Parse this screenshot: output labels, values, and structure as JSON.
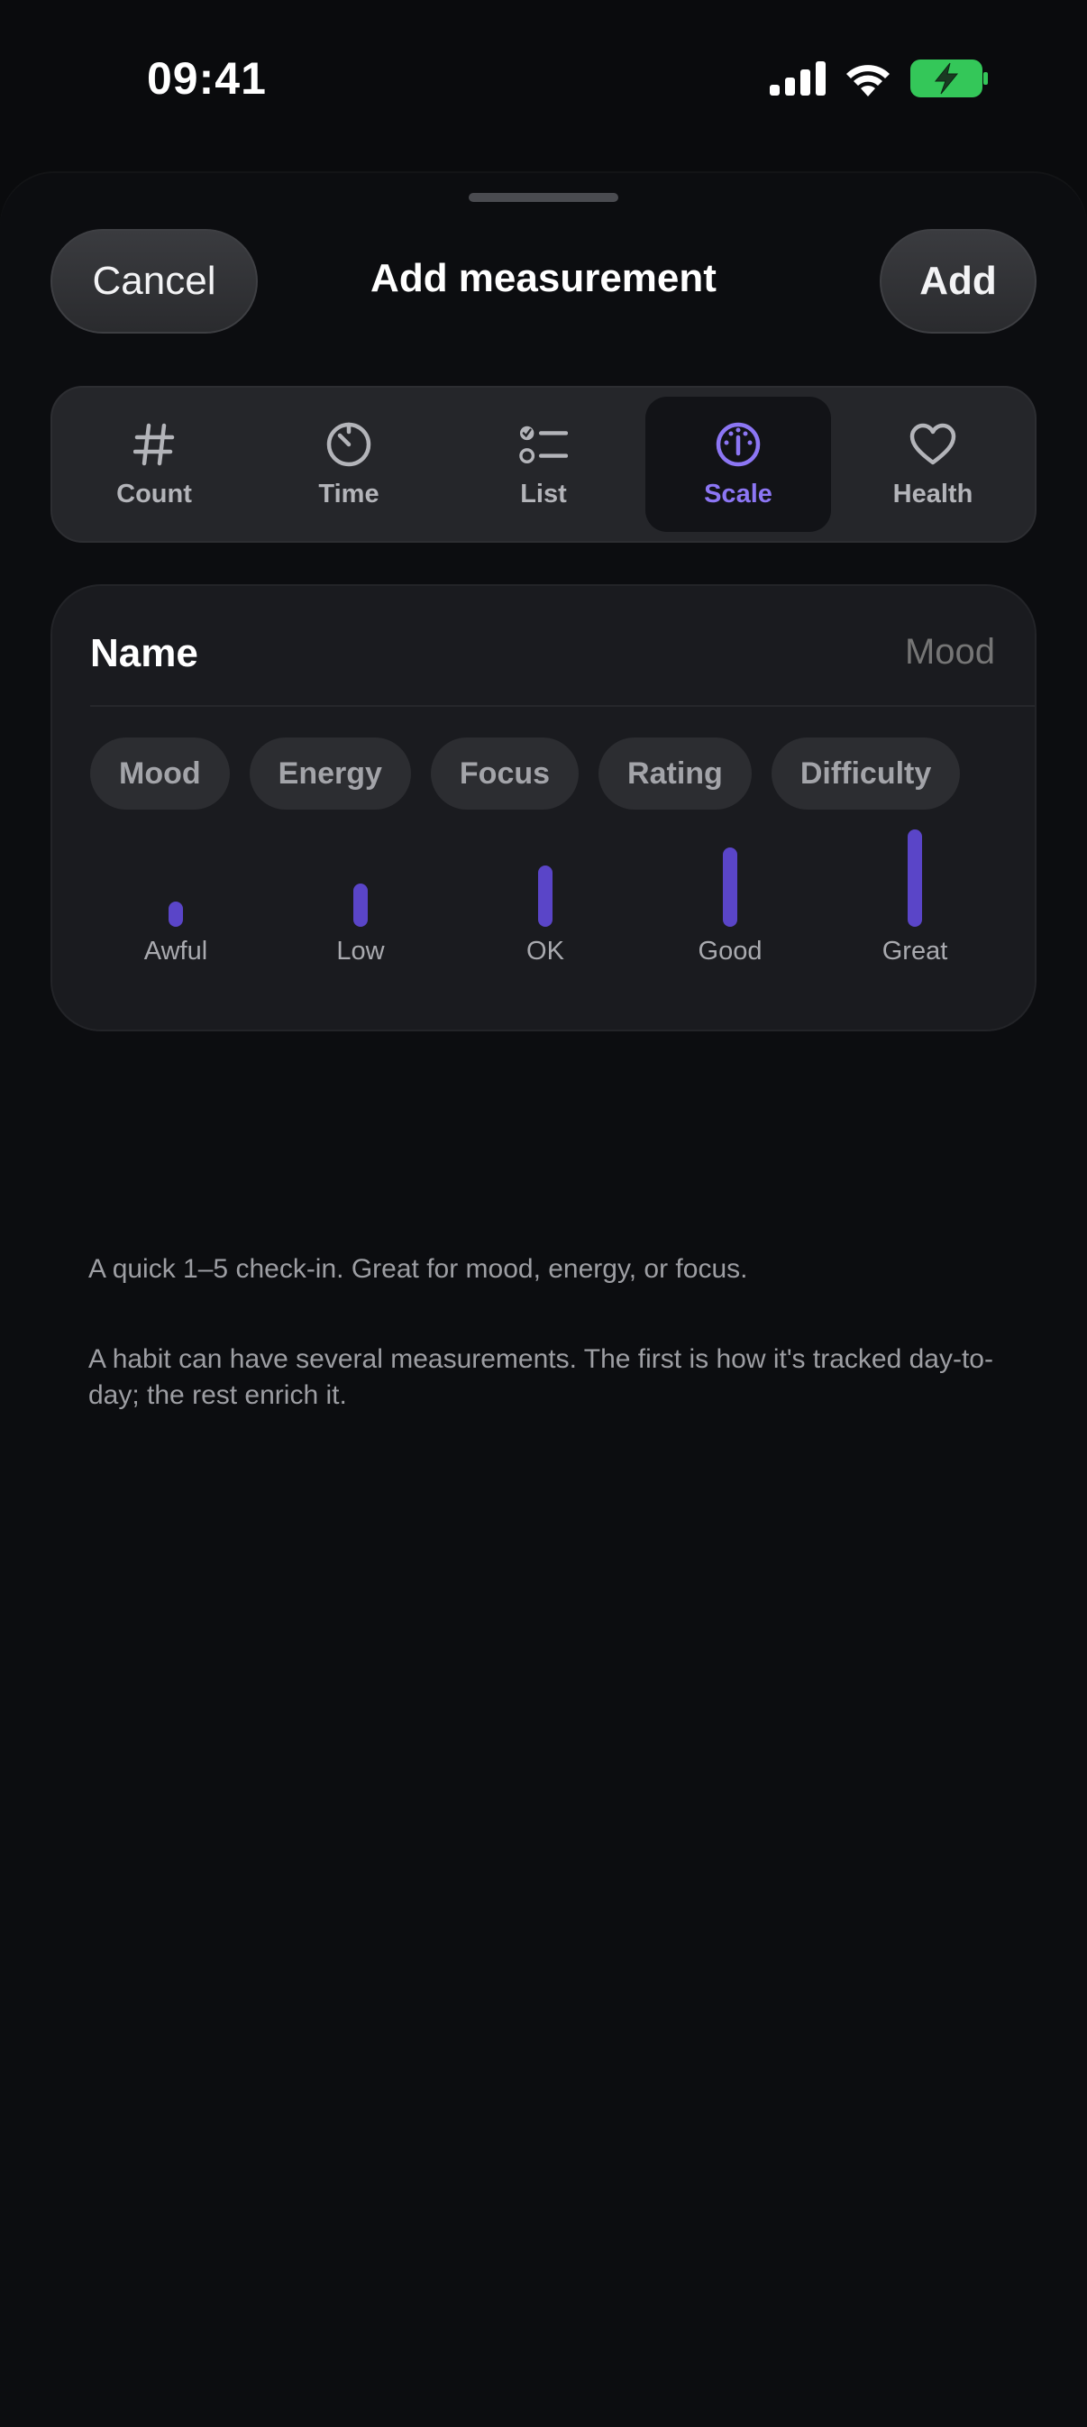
{
  "status_bar": {
    "time": "09:41",
    "icons": [
      "cellular-signal-icon",
      "wifi-icon",
      "battery-charging-icon"
    ],
    "battery_color": "#34c759"
  },
  "header": {
    "cancel_label": "Cancel",
    "title": "Add measurement",
    "add_label": "Add"
  },
  "types": {
    "selected": "Scale",
    "accent_color": "#8c76f4",
    "items": [
      {
        "label": "Count",
        "icon": "hash-icon"
      },
      {
        "label": "Time",
        "icon": "timer-icon"
      },
      {
        "label": "List",
        "icon": "checklist-icon"
      },
      {
        "label": "Scale",
        "icon": "gauge-icon"
      },
      {
        "label": "Health",
        "icon": "heart-icon"
      }
    ]
  },
  "form": {
    "name_label": "Name",
    "name_placeholder": "Mood",
    "name_value": "",
    "suggestions": [
      "Mood",
      "Energy",
      "Focus",
      "Rating",
      "Difficulty"
    ],
    "scale": {
      "levels": [
        {
          "label": "Awful",
          "value": 1
        },
        {
          "label": "Low",
          "value": 2
        },
        {
          "label": "OK",
          "value": 3
        },
        {
          "label": "Good",
          "value": 4
        },
        {
          "label": "Great",
          "value": 5
        }
      ]
    }
  },
  "notes": {
    "type_description": "A quick 1–5 check-in. Great for mood, energy, or focus.",
    "habit_description": "A habit can have several measurements. The first is how it's tracked day-to-day; the rest enrich it."
  }
}
